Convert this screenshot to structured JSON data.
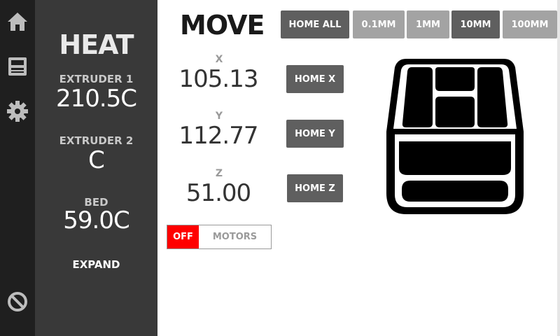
{
  "sidebar": {
    "items": [
      {
        "icon": "home-icon"
      },
      {
        "icon": "printer-display-icon"
      },
      {
        "icon": "gear-icon"
      },
      {
        "icon": "stop-icon"
      }
    ]
  },
  "heat": {
    "title": "HEAT",
    "extruder1": {
      "label": "EXTRUDER 1",
      "value": "210.5C"
    },
    "extruder2": {
      "label": "EXTRUDER 2",
      "value": "C"
    },
    "bed": {
      "label": "BED",
      "value": "59.0C"
    },
    "expand_label": "EXPAND"
  },
  "move": {
    "title": "MOVE",
    "home_all_label": "HOME ALL",
    "steps": [
      {
        "label": "0.1MM",
        "selected": false
      },
      {
        "label": "1MM",
        "selected": false
      },
      {
        "label": "10MM",
        "selected": true
      },
      {
        "label": "100MM",
        "selected": false
      }
    ],
    "axes": [
      {
        "label": "X",
        "value": "105.13",
        "home_label": "HOME X"
      },
      {
        "label": "Y",
        "value": "112.77",
        "home_label": "HOME Y"
      },
      {
        "label": "Z",
        "value": "51.00",
        "home_label": "HOME Z"
      }
    ],
    "motors": {
      "state_label": "OFF",
      "label": "MOTORS"
    }
  },
  "colors": {
    "rail": "#1f1f1f",
    "heat_panel": "#393939",
    "button_dark": "#5f5f5f",
    "button_light": "#a3a3a3",
    "motors_off": "#ff0000"
  }
}
